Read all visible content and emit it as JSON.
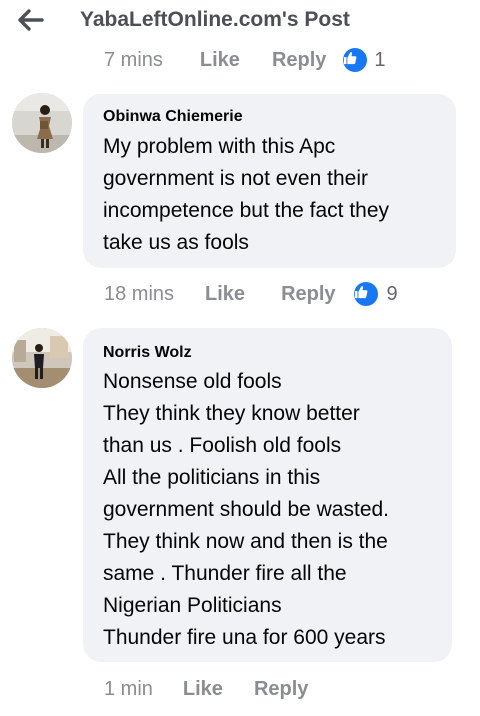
{
  "header": {
    "title": "YabaLeftOnline.com's Post",
    "back_icon": "arrow-left-icon"
  },
  "comments": [
    {
      "time": "7 mins",
      "like_label": "Like",
      "reply_label": "Reply",
      "reaction_icon": "thumbs-up-icon",
      "reaction_count": "1"
    },
    {
      "author": "Obinwa Chiemerie",
      "lines": [
        "My problem with this Apc",
        "government is not even their",
        "incompetence but the fact they",
        "take us as fools"
      ],
      "time": "18 mins",
      "like_label": "Like",
      "reply_label": "Reply",
      "reaction_icon": "thumbs-up-icon",
      "reaction_count": "9"
    },
    {
      "author": "Norris Wolz",
      "lines": [
        "Nonsense old fools",
        "They think they know better",
        "than us . Foolish old fools",
        "All the politicians in this",
        "government should be wasted.",
        "They think now and then is the",
        "same . Thunder fire all the",
        "Nigerian Politicians",
        "Thunder fire una for 600 years"
      ],
      "time": "1 min",
      "like_label": "Like",
      "reply_label": "Reply"
    }
  ],
  "colors": {
    "accent": "#1877f2",
    "bubble": "#f0f2f5",
    "meta_text": "#8a8d91",
    "header_text": "#4b4f56"
  }
}
